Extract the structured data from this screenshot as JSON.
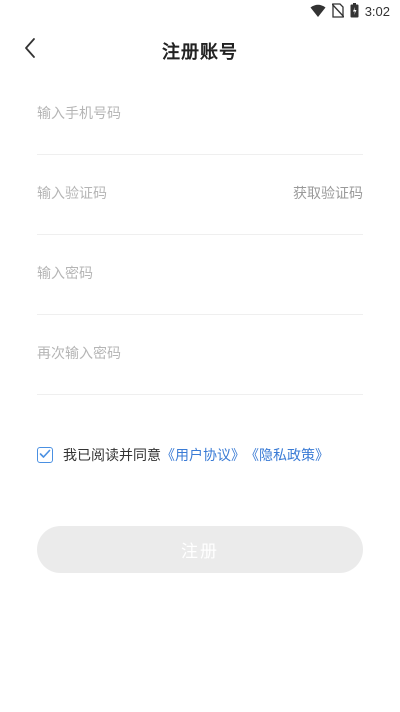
{
  "status_bar": {
    "time": "3:02",
    "icons": [
      "wifi-icon",
      "no-sim-icon",
      "battery-icon"
    ]
  },
  "header": {
    "title": "注册账号",
    "back_icon": "chevron-left-icon"
  },
  "form": {
    "phone_placeholder": "输入手机号码",
    "code_placeholder": "输入验证码",
    "get_code_label": "获取验证码",
    "password_placeholder": "输入密码",
    "confirm_placeholder": "再次输入密码"
  },
  "agreement": {
    "checked": true,
    "text": "我已阅读并同意",
    "user_agreement": "《用户协议》",
    "privacy_policy": "《隐私政策》"
  },
  "submit": {
    "label": "注册"
  },
  "colors": {
    "accent": "#3a7bd5",
    "checkbox": "#4a90e2",
    "button_disabled": "#ebebeb",
    "placeholder": "#b5b5b5"
  }
}
